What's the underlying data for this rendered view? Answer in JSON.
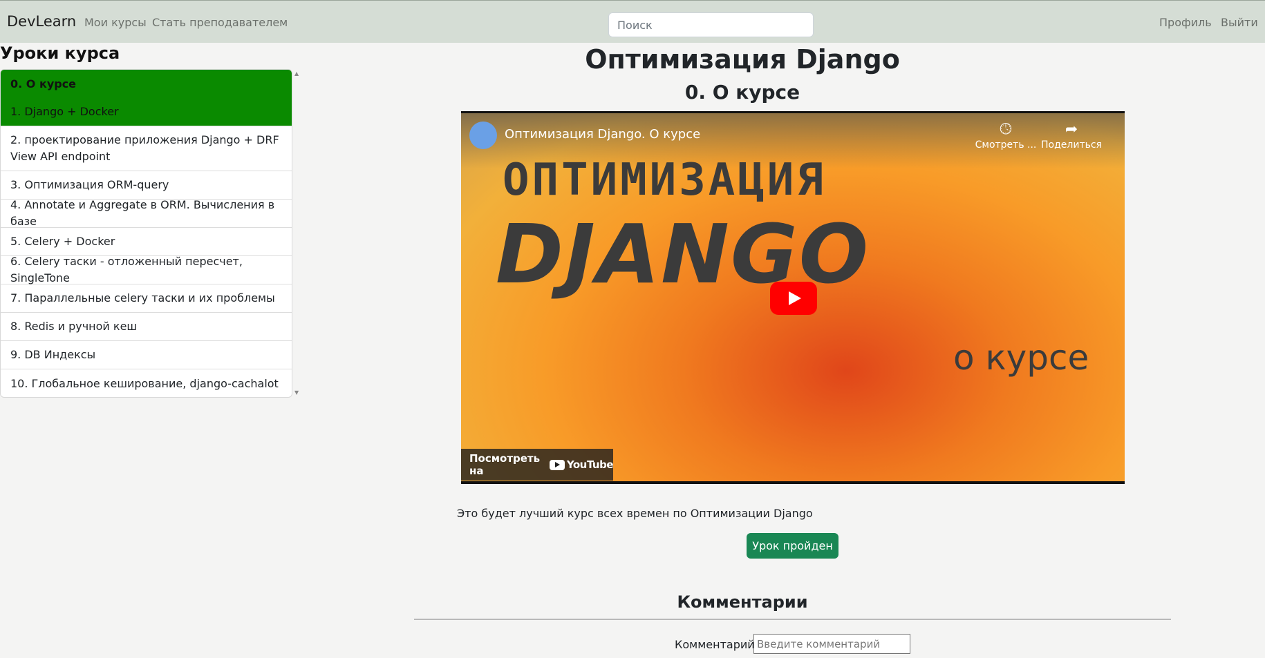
{
  "navbar": {
    "brand": "DevLearn",
    "links": [
      "Мои курсы",
      "Стать преподавателем"
    ],
    "search_placeholder": "Поиск",
    "right_links": [
      "Профиль",
      "Выйти"
    ]
  },
  "sidebar": {
    "title": "Уроки курса",
    "lessons": [
      "0. О курсе",
      "1. Django + Docker",
      "2. проектирование приложения Django + DRF View API endpoint",
      "3. Оптимизация ORM-query",
      "4. Annotate и Aggregate в ORM. Вычисления в базе",
      "5. Celery + Docker",
      "6. Celery таски - отложенный пересчет, SingleTone",
      "7. Параллельные celery таски и их проблемы",
      "8. Redis и ручной кеш",
      "9. DB Индексы",
      "10. Глобальное кеширование, django-cachalot"
    ]
  },
  "main": {
    "course_title": "Оптимизация Django",
    "lesson_title": "0. О курсе",
    "video": {
      "caption": "Оптимизация Django. О курсе",
      "watch_later": "Смотреть ...",
      "share": "Поделиться",
      "thumb_line1": "ОПТИМИЗАЦИЯ",
      "thumb_line2": "DJANGO",
      "thumb_line3": "о курсе",
      "watch_on": "Посмотреть на",
      "youtube": "YouTube"
    },
    "description": "Это будет лучший курс всех времен по Оптимизации Django",
    "done_button": "Урок пройден",
    "comments_title": "Комментарии",
    "comment_label": "Комментарий:",
    "comment_placeholder": "Введите комментарий"
  },
  "colors": {
    "navbar_bg": "#d5ddd5",
    "active_lesson": "#0a8a00",
    "done_button": "#198754",
    "youtube_red": "#ff0000"
  }
}
